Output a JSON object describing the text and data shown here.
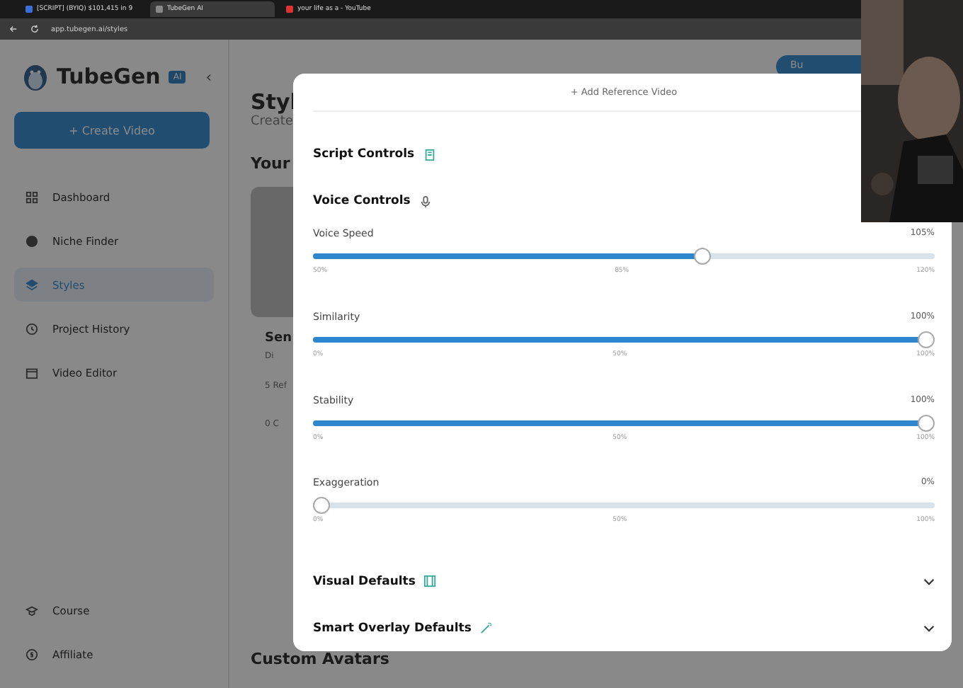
{
  "browser": {
    "tabs": [
      {
        "title": "[SCRIPT] (BYIQ) $101,415 in 9",
        "selected": false
      },
      {
        "title": "TubeGen AI",
        "selected": true
      },
      {
        "title": "your life as a - YouTube",
        "selected": false
      }
    ],
    "url": "app.tubegen.ai/styles"
  },
  "sidebar": {
    "brand": "TubeGen",
    "badge": "AI",
    "create_button": "+ Create Video",
    "collapse": "‹",
    "nav": [
      {
        "label": "Dashboard",
        "selected": false
      },
      {
        "label": "Niche Finder",
        "selected": false
      },
      {
        "label": "Styles",
        "selected": true
      },
      {
        "label": "Project History",
        "selected": false
      },
      {
        "label": "Video Editor",
        "selected": false
      }
    ],
    "footer_nav": [
      {
        "label": "Course",
        "selected": false
      },
      {
        "label": "Affiliate",
        "selected": false
      }
    ]
  },
  "main": {
    "top_button": "Bu",
    "title": "Styl",
    "subtitle": "Create",
    "section": "Your",
    "card": {
      "title": "Sen",
      "voice": "Di",
      "refs": "5 Ref",
      "count": "0 C"
    },
    "bottom_heading": "Custom Avatars"
  },
  "modal": {
    "add_reference": "+ Add Reference Video",
    "sections": [
      {
        "title": "Script Controls",
        "expanded": false,
        "chevron": false
      },
      {
        "title": "Voice Controls",
        "expanded": true,
        "chevron": false,
        "sliders": [
          {
            "label": "Voice Speed",
            "reading": "105%",
            "level": 0.63,
            "ticks": [
              "50%",
              "85%",
              "120%"
            ]
          },
          {
            "label": "Similarity",
            "reading": "100%",
            "level": 1,
            "ticks": [
              "0%",
              "50%",
              "100%"
            ]
          },
          {
            "label": "Stability",
            "reading": "100%",
            "level": 1,
            "ticks": [
              "0%",
              "50%",
              "100%"
            ]
          },
          {
            "label": "Exaggeration",
            "reading": "0%",
            "level": 0,
            "ticks": [
              "0%",
              "50%",
              "100%"
            ]
          }
        ]
      },
      {
        "title": "Visual Defaults",
        "expanded": false,
        "chevron": true
      },
      {
        "title": "Smart Overlay Defaults",
        "expanded": false,
        "chevron": true
      }
    ]
  }
}
